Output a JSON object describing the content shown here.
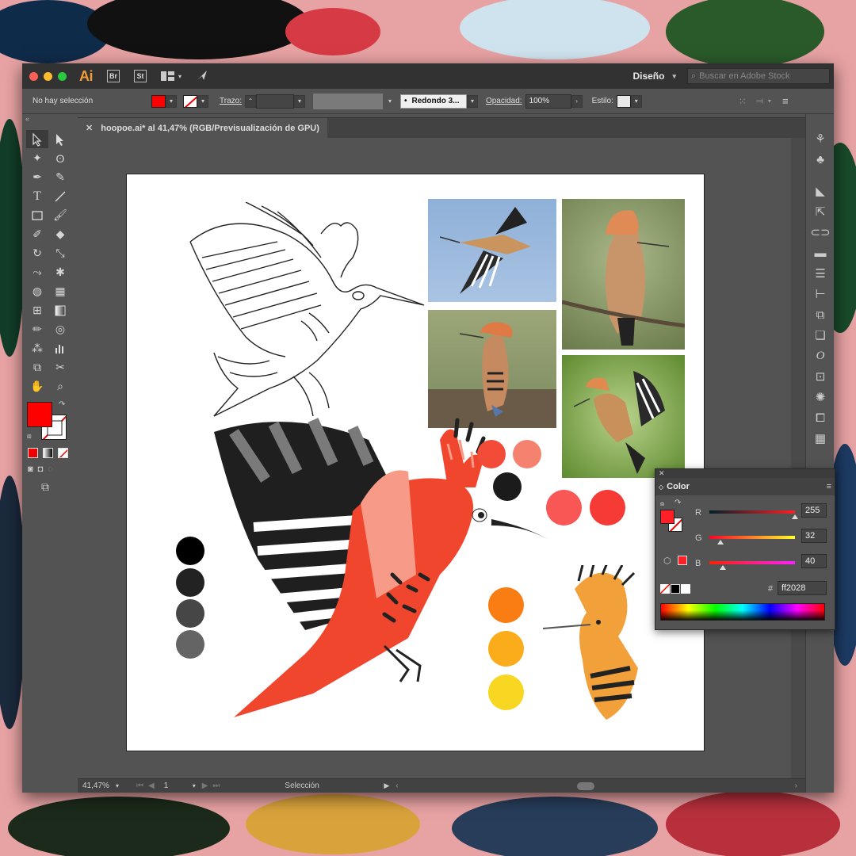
{
  "app": {
    "logo": "Ai",
    "bridge": "Br",
    "stock": "St",
    "workspace": "Diseño",
    "search_placeholder": "Buscar en Adobe Stock"
  },
  "control_bar": {
    "selection_status": "No hay selección",
    "stroke_label": "Trazo:",
    "brush_label": "Redondo 3...",
    "opacity_label": "Opacidad:",
    "opacity_value": "100%",
    "style_label": "Estilo:"
  },
  "document": {
    "tab_title": "hoopoe.ai* al 41,47% (RGB/Previsualización de GPU)"
  },
  "status_bar": {
    "zoom": "41,47%",
    "artboard_number": "1",
    "tool_name": "Selección"
  },
  "color_panel": {
    "title": "Color",
    "r_label": "R",
    "g_label": "G",
    "b_label": "B",
    "r_value": "255",
    "g_value": "32",
    "b_value": "40",
    "hex_label": "#",
    "hex_value": "ff2028"
  },
  "colors": {
    "fill": "#ff2028",
    "swatches_black": [
      "#000000",
      "#222222",
      "#464646",
      "#646464"
    ],
    "swatches_top": [
      "#f24b37",
      "#f4826e",
      "#1b1b1b"
    ],
    "swatches_red": [
      "#f85756",
      "#f63a35"
    ],
    "swatches_yellow": [
      "#f97d12",
      "#fbac1a",
      "#f8d722"
    ]
  }
}
